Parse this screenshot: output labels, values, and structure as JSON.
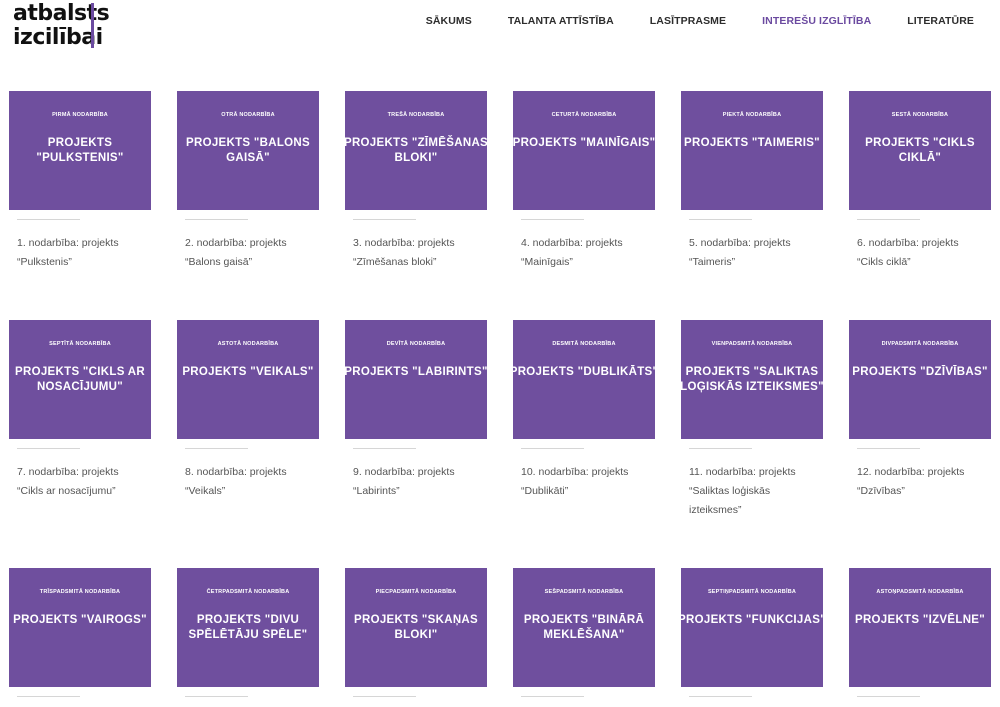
{
  "logo": {
    "line1": "atbalsts",
    "line2": "izcilībai"
  },
  "nav": [
    {
      "label": "SĀKUMS",
      "active": false
    },
    {
      "label": "TALANTA ATTĪSTĪBA",
      "active": false
    },
    {
      "label": "LASĪTPRASME",
      "active": false
    },
    {
      "label": "INTEREŠU IZGLĪTĪBA",
      "active": true
    },
    {
      "label": "LITERATŪRE",
      "active": false
    }
  ],
  "colors": {
    "tile": "#6f4f9e",
    "accent": "#6b4aa0"
  },
  "cards": [
    {
      "sub": "PIRMĀ NODARBĪBA",
      "title": "PROJEKTS \"PULKSTENIS\"",
      "caption": "1. nodarbība: projekts “Pulkstenis”"
    },
    {
      "sub": "OTRĀ NODARBĪBA",
      "title": "PROJEKTS \"BALONS GAISĀ\"",
      "caption": "2. nodarbība: projekts “Balons gaisā”"
    },
    {
      "sub": "TREŠĀ NODARBĪBA",
      "title": "PROJEKTS \"ZĪMĒŠANAS BLOKI\"",
      "caption": "3. nodarbība: projekts “Zīmēšanas bloki”"
    },
    {
      "sub": "CETURTĀ NODARBĪBA",
      "title": "PROJEKTS \"MAINĪGAIS\"",
      "caption": "4. nodarbība: projekts “Mainīgais”"
    },
    {
      "sub": "PIEKTĀ NODARBĪBA",
      "title": "PROJEKTS \"TAIMERIS\"",
      "caption": "5. nodarbība: projekts “Taimeris”"
    },
    {
      "sub": "SESTĀ NODARBĪBA",
      "title": "PROJEKTS \"CIKLS CIKLĀ\"",
      "caption": "6. nodarbība: projekts “Cikls ciklā”"
    },
    {
      "sub": "SEPTĪTĀ NODARBĪBA",
      "title": "PROJEKTS \"CIKLS AR NOSACĪJUMU\"",
      "caption": "7. nodarbība: projekts “Cikls ar nosacījumu”"
    },
    {
      "sub": "ASTOTĀ NODARBĪBA",
      "title": "PROJEKTS \"VEIKALS\"",
      "caption": "8. nodarbība: projekts “Veikals”"
    },
    {
      "sub": "DEVĪTĀ NODARBĪBA",
      "title": "PROJEKTS \"LABIRINTS\"",
      "caption": "9. nodarbība: projekts “Labirints”"
    },
    {
      "sub": "DESMITĀ NODARBĪBA",
      "title": "PROJEKTS \"DUBLIKĀTS\"",
      "caption": "10. nodarbība: projekts “Dublikāti”"
    },
    {
      "sub": "VIENPADSMITĀ NODARBĪBA",
      "title": "PROJEKTS \"SALIKTAS LOĢISKĀS IZTEIKSMES\"",
      "caption": "11. nodarbība: projekts “Saliktas loģiskās izteiksmes”"
    },
    {
      "sub": "DIVPADSMITĀ NODARBĪBA",
      "title": "PROJEKTS \"DZĪVĪBAS\"",
      "caption": "12. nodarbība: projekts “Dzīvības”"
    },
    {
      "sub": "TRĪSPADSMITĀ NODARBĪBA",
      "title": "PROJEKTS \"VAIROGS\"",
      "caption": ""
    },
    {
      "sub": "ČETRPADSMITĀ NODARBĪBA",
      "title": "PROJEKTS \"DIVU SPĒLĒTĀJU SPĒLE\"",
      "caption": ""
    },
    {
      "sub": "PIECPADSMITĀ NODARBĪBA",
      "title": "PROJEKTS \"SKAŅAS BLOKI\"",
      "caption": ""
    },
    {
      "sub": "SEŠPADSMITĀ NODARBĪBA",
      "title": "PROJEKTS \"BINĀRĀ MEKLĒŠANA\"",
      "caption": ""
    },
    {
      "sub": "SEPTIŅPADSMITĀ NODARBĪBA",
      "title": "PROJEKTS \"FUNKCIJAS\"",
      "caption": ""
    },
    {
      "sub": "ASTOŅPADSMITĀ NODARBĪBA",
      "title": "PROJEKTS \"IZVĒLNE\"",
      "caption": ""
    }
  ]
}
